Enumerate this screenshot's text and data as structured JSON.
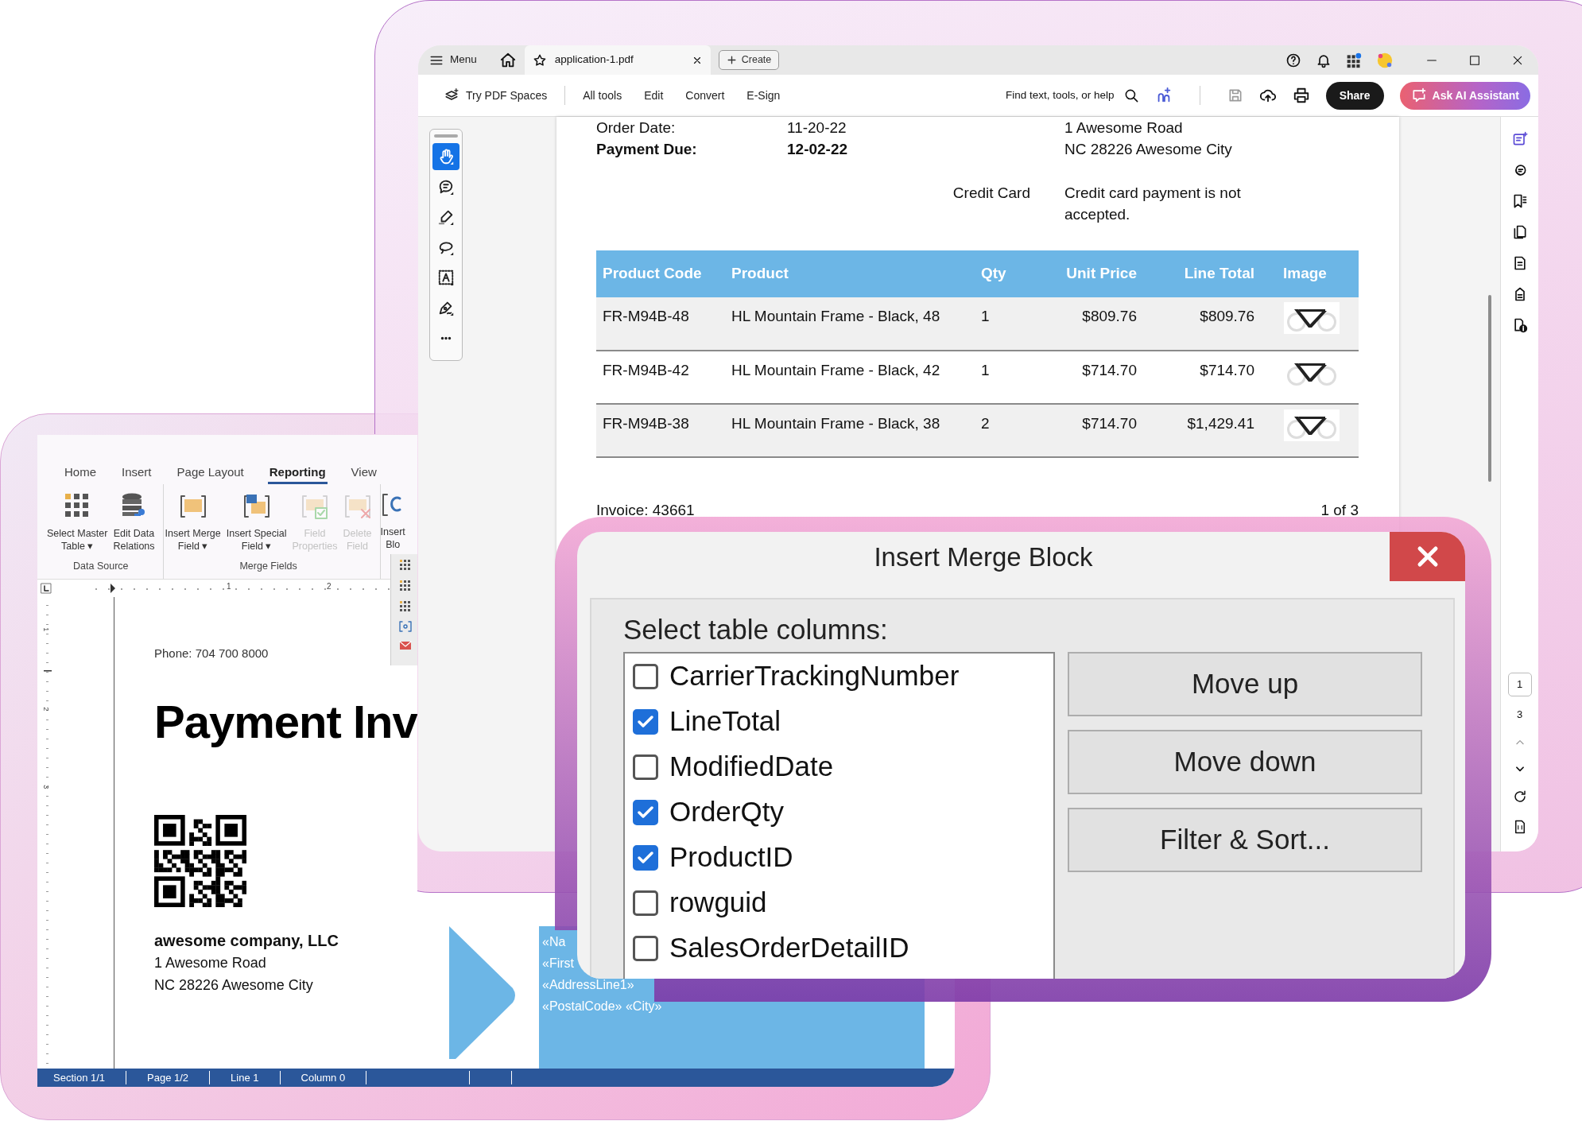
{
  "word_window": {
    "tabs": [
      {
        "label": "Home",
        "selected": false
      },
      {
        "label": "Insert",
        "selected": false
      },
      {
        "label": "Page Layout",
        "selected": false
      },
      {
        "label": "Reporting",
        "selected": true
      },
      {
        "label": "View",
        "selected": false
      }
    ],
    "ribbon_groups": [
      {
        "label": "Data Source",
        "buttons": [
          {
            "kind": "grid",
            "label": "Select Master\nTable ▾",
            "disabled": false
          },
          {
            "kind": "database",
            "label": "Edit Data\nRelations",
            "disabled": false
          }
        ]
      },
      {
        "label": "Merge Fields",
        "buttons": [
          {
            "kind": "merge-field",
            "label": "Insert Merge\nField ▾",
            "disabled": false
          },
          {
            "kind": "special-field",
            "label": "Insert Special\nField ▾",
            "disabled": false
          },
          {
            "kind": "field-properties",
            "label": "Field\nProperties",
            "disabled": true
          },
          {
            "kind": "delete-field",
            "label": "Delete\nField",
            "disabled": true
          }
        ]
      }
    ],
    "cut_button": {
      "kind": "merge-block",
      "label": "Insert\nBlo"
    },
    "ruler_marks": [
      "1",
      "2"
    ],
    "vertical_ruler_marks": [
      "1",
      "2",
      "3"
    ],
    "document": {
      "phone": "Phone: 704 700 8000",
      "heading": "Payment Inv",
      "company": "awesome company, LLC",
      "address_lines": [
        "1 Awesome Road",
        "NC 28226 Awesome City"
      ],
      "merge_fields": [
        "«Na",
        "«First",
        "«AddressLine1»",
        "«PostalCode» «City»"
      ]
    },
    "status_bar": [
      "Section 1/1",
      "Page 1/2",
      "Line 1",
      "Column 0"
    ]
  },
  "pdf_window": {
    "menu_label": "Menu",
    "tab_title": "application-1.pdf",
    "create_label": "Create",
    "toolbar": {
      "spaces": "Try PDF Spaces",
      "menus": [
        "All tools",
        "Edit",
        "Convert",
        "E-Sign"
      ],
      "search_label": "Find text, tools, or help",
      "share": "Share",
      "ai": "Ask AI Assistant"
    },
    "tools": [
      {
        "kind": "hand",
        "selected": true
      },
      {
        "kind": "comment",
        "selected": false
      },
      {
        "kind": "highlight",
        "selected": false
      },
      {
        "kind": "lasso",
        "selected": false
      },
      {
        "kind": "text-box",
        "selected": false
      },
      {
        "kind": "sign",
        "selected": false
      },
      {
        "kind": "more",
        "selected": false
      }
    ],
    "invoice": {
      "meta_rows": [
        {
          "label": "Order Date:",
          "value": "11-20-22",
          "address": "1 Awesome Road",
          "bold": false
        },
        {
          "label": "Payment Due:",
          "value": "12-02-22",
          "address": "NC 28226 Awesome City",
          "bold": true
        }
      ],
      "payment": {
        "method": "Credit Card",
        "note": "Credit card payment is not accepted."
      },
      "table": {
        "columns": [
          "Product Code",
          "Product",
          "Qty",
          "Unit Price",
          "Line Total",
          "Image"
        ],
        "rows": [
          {
            "cells": [
              "FR-M94B-48",
              "HL Mountain Frame - Black, 48",
              "1",
              "$809.76",
              "$809.76"
            ],
            "image": {
              "kind": "picture"
            }
          },
          {
            "cells": [
              "FR-M94B-42",
              "HL Mountain Frame - Black, 42",
              "1",
              "$714.70",
              "$714.70"
            ],
            "image": {
              "kind": "picture"
            }
          },
          {
            "cells": [
              "FR-M94B-38",
              "HL Mountain Frame - Black, 38",
              "2",
              "$714.70",
              "$1,429.41"
            ],
            "image": {
              "kind": "picture"
            }
          }
        ]
      },
      "footer_left": "Invoice: 43661",
      "footer_right": "1 of 3"
    },
    "page_nav": {
      "current": "1",
      "total": "3"
    }
  },
  "dialog": {
    "title": "Insert Merge Block",
    "prompt": "Select table columns:",
    "columns": [
      {
        "label": "CarrierTrackingNumber",
        "checked": false
      },
      {
        "label": "LineTotal",
        "checked": true
      },
      {
        "label": "ModifiedDate",
        "checked": false
      },
      {
        "label": "OrderQty",
        "checked": true
      },
      {
        "label": "ProductID",
        "checked": true
      },
      {
        "label": "rowguid",
        "checked": false
      },
      {
        "label": "SalesOrderDetailID",
        "checked": false
      }
    ],
    "buttons": [
      "Move up",
      "Move down",
      "Filter & Sort..."
    ]
  }
}
